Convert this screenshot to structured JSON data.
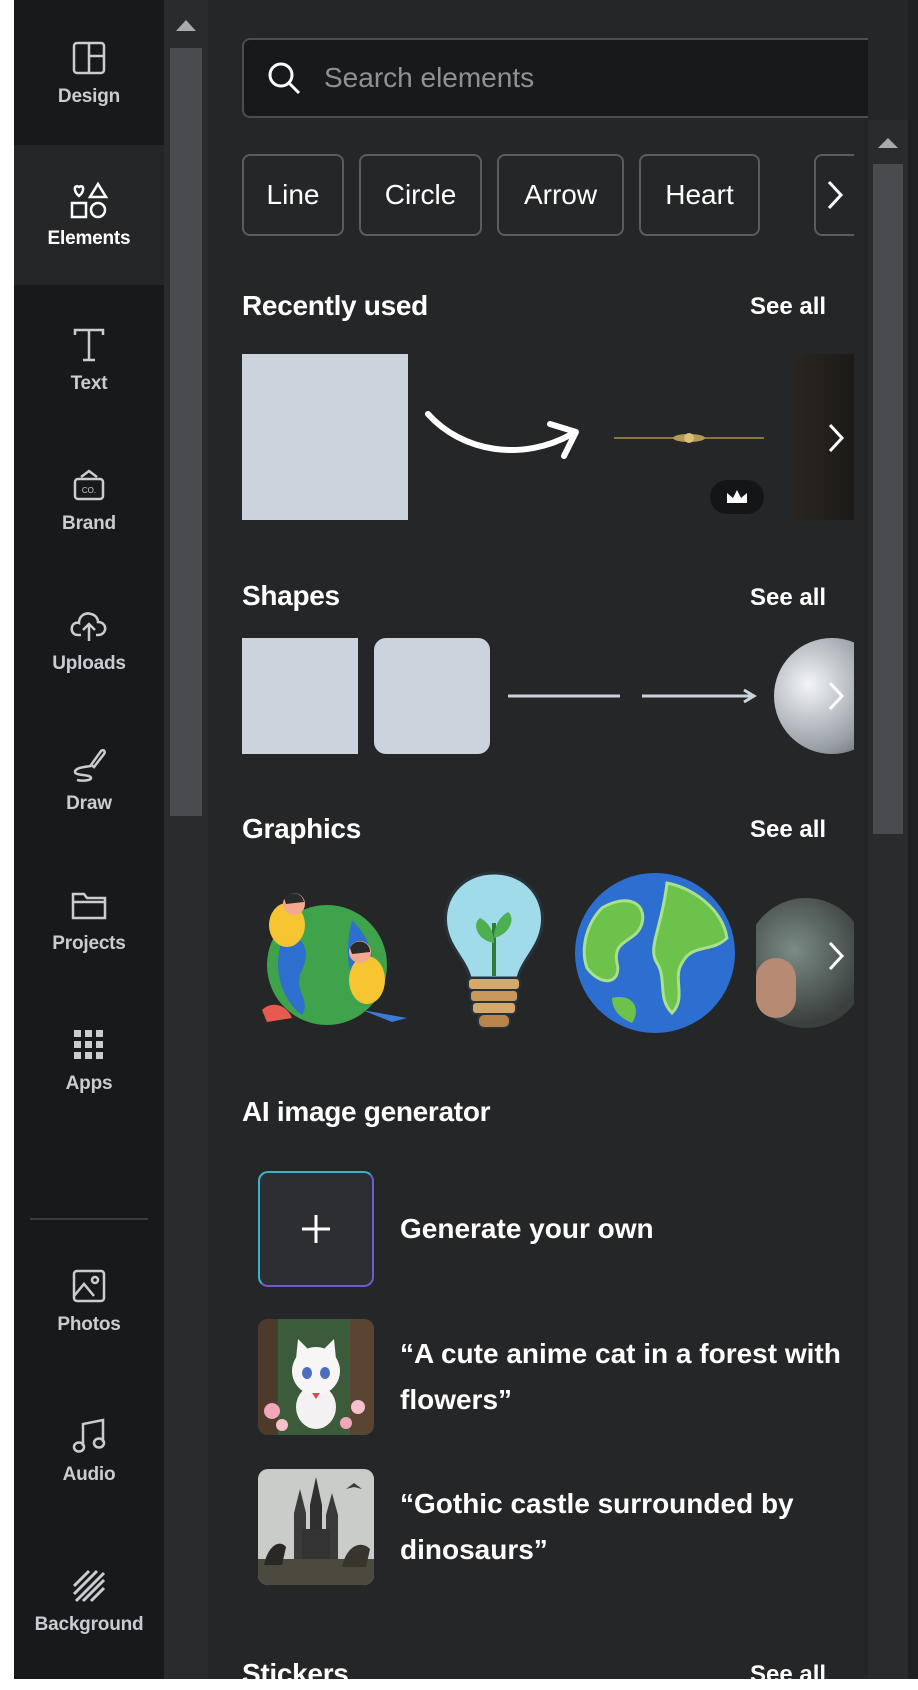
{
  "sidebar": {
    "items": [
      {
        "label": "Design",
        "icon": "layout-icon"
      },
      {
        "label": "Elements",
        "icon": "shapes-icon",
        "active": true
      },
      {
        "label": "Text",
        "icon": "text-icon"
      },
      {
        "label": "Brand",
        "icon": "brand-icon"
      },
      {
        "label": "Uploads",
        "icon": "cloud-upload-icon"
      },
      {
        "label": "Draw",
        "icon": "pen-icon"
      },
      {
        "label": "Projects",
        "icon": "folder-icon"
      },
      {
        "label": "Apps",
        "icon": "grid-icon"
      },
      {
        "label": "Photos",
        "icon": "image-icon"
      },
      {
        "label": "Audio",
        "icon": "music-note-icon"
      },
      {
        "label": "Background",
        "icon": "hatch-icon"
      }
    ]
  },
  "search": {
    "placeholder": "Search elements"
  },
  "chips": [
    "Line",
    "Circle",
    "Arrow",
    "Heart"
  ],
  "sections": {
    "recent": {
      "title": "Recently used",
      "see_all": "See all"
    },
    "shapes": {
      "title": "Shapes",
      "see_all": "See all"
    },
    "graphics": {
      "title": "Graphics",
      "see_all": "See all"
    },
    "ai": {
      "title": "AI image generator"
    },
    "stickers": {
      "title": "Stickers",
      "see_all": "See all"
    }
  },
  "ai_items": [
    {
      "text": "Generate your own"
    },
    {
      "text": "“A cute anime cat in a forest with flowers”"
    },
    {
      "text": "“Gothic castle surrounded by dinosaurs”"
    }
  ],
  "colors": {
    "sidebar_bg": "#18191b",
    "panel_bg": "#252627",
    "shape_fill": "#cbd3dc"
  }
}
